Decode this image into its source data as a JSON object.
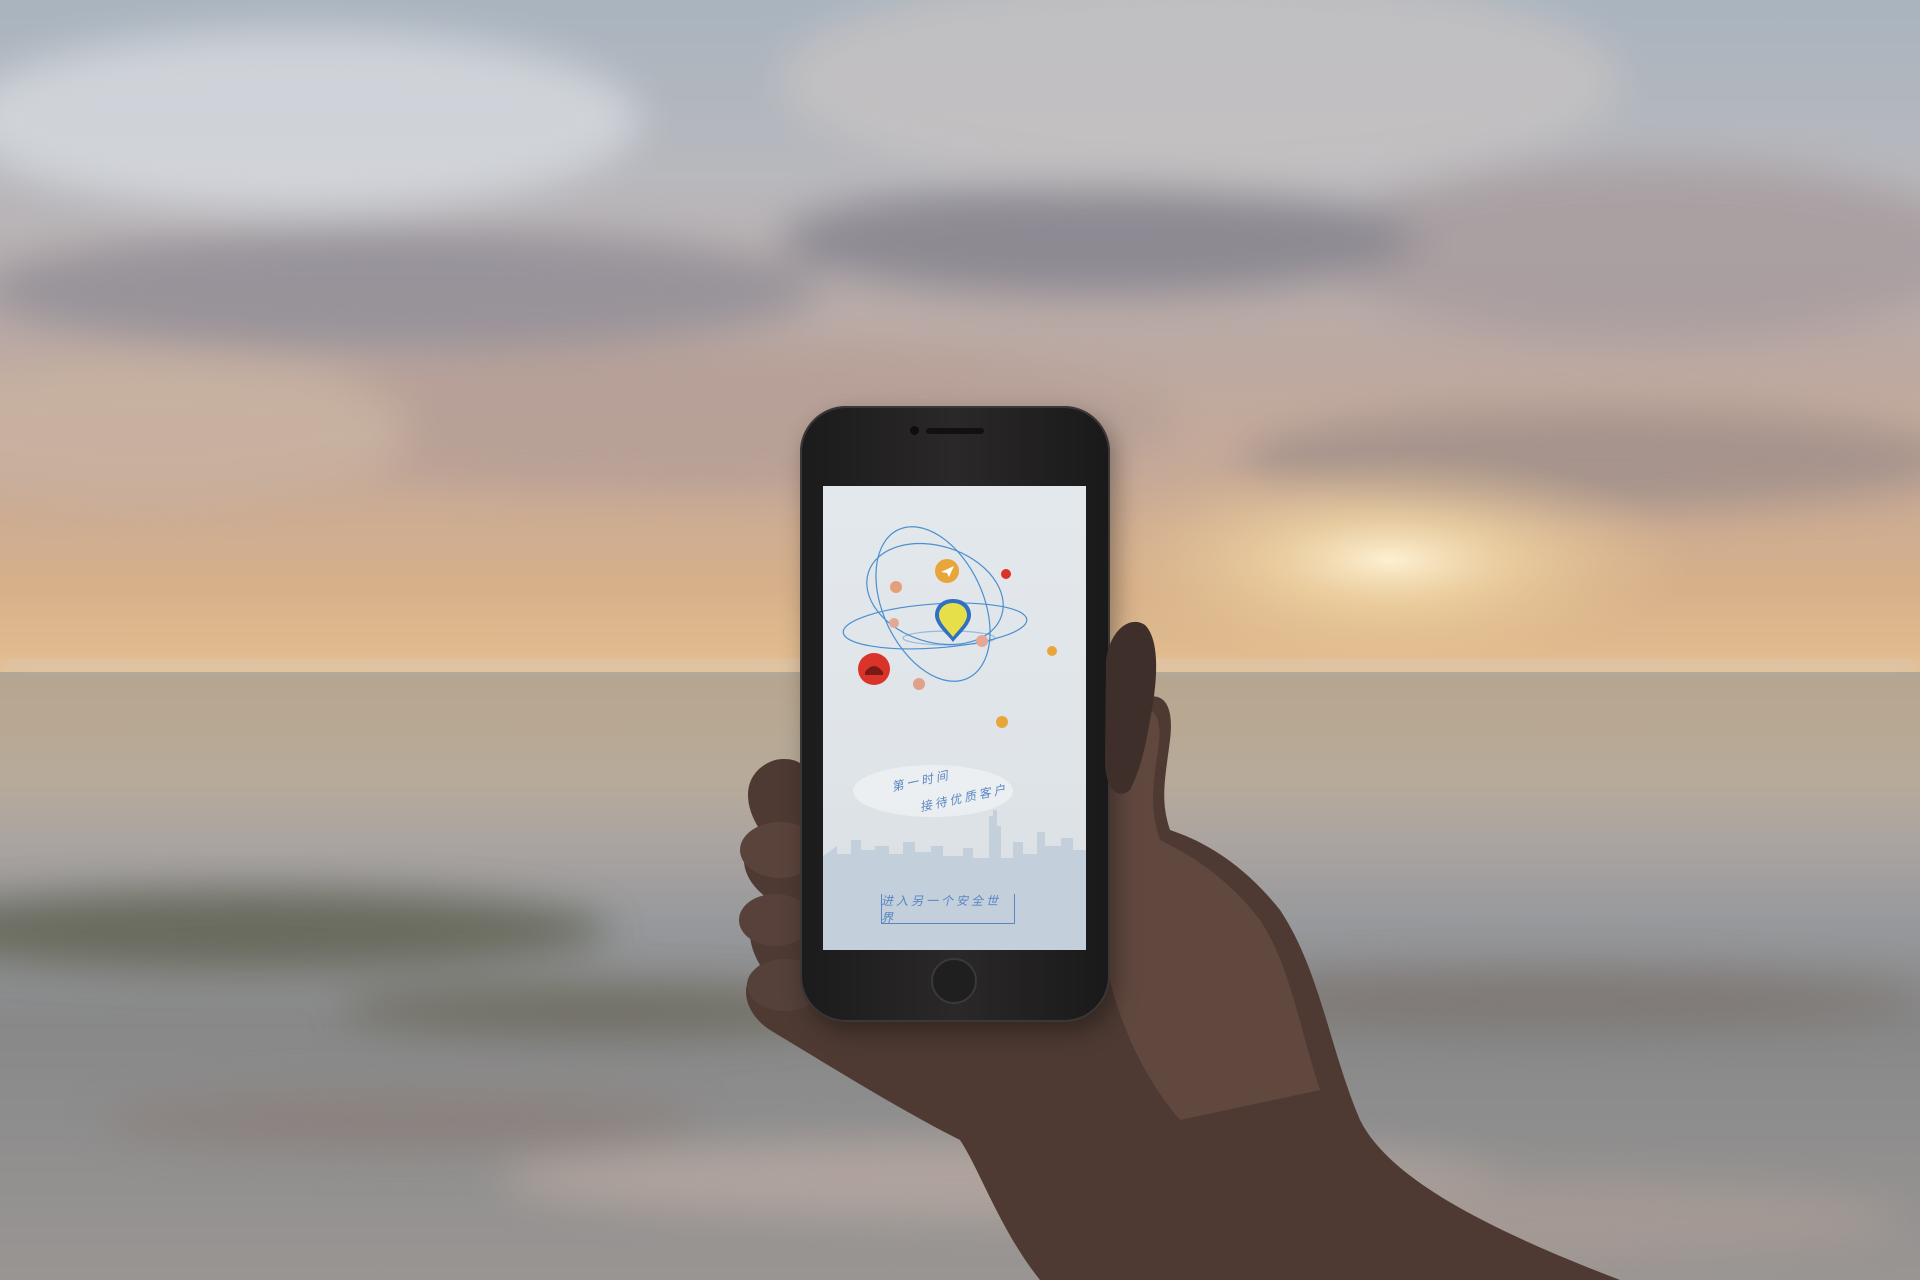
{
  "app_screen": {
    "tagline_line1": "第一时间",
    "tagline_line2": "接待优质客户",
    "enter_button_label": "进入另一个安全世界"
  },
  "colors": {
    "sky_top": "#a9b4bf",
    "sunset_glow": "#e8c492",
    "sea": "#8d8c8c",
    "screen_bg": "#e3e8ec",
    "accent_blue": "#5b86c4",
    "red_planet": "#d9332a",
    "orange_planet": "#e8a53a",
    "pin_yellow": "#e6df4a"
  },
  "icons": [
    "location-pin-icon",
    "paper-plane-icon",
    "avatar-icon",
    "orbit-icon"
  ]
}
